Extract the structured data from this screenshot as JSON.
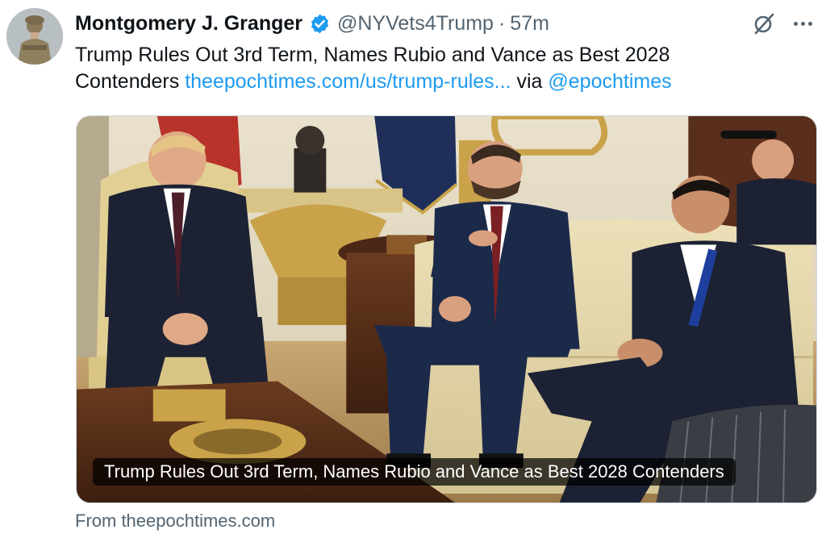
{
  "author": {
    "display_name": "Montgomery J. Granger",
    "handle": "@NYVets4Trump",
    "separator": "·",
    "time": "57m",
    "avatar_icon": "avatar-photo",
    "verified_icon": "verified-badge-icon"
  },
  "tweet": {
    "text_line1": "Trump Rules Out 3rd Term, Names Rubio and Vance as Best 2028",
    "text_line2_prefix": "Contenders ",
    "link": "theepochtimes.com/us/trump-rules...",
    "via": " via ",
    "mention": "@epochtimes"
  },
  "media": {
    "caption": "Trump Rules Out 3rd Term, Names Rubio and Vance as Best 2028 Contenders",
    "source": "From theepochtimes.com"
  },
  "colors": {
    "link": "#1d9bf0",
    "secondary_text": "#536471",
    "verified": "#1d9bf0"
  }
}
